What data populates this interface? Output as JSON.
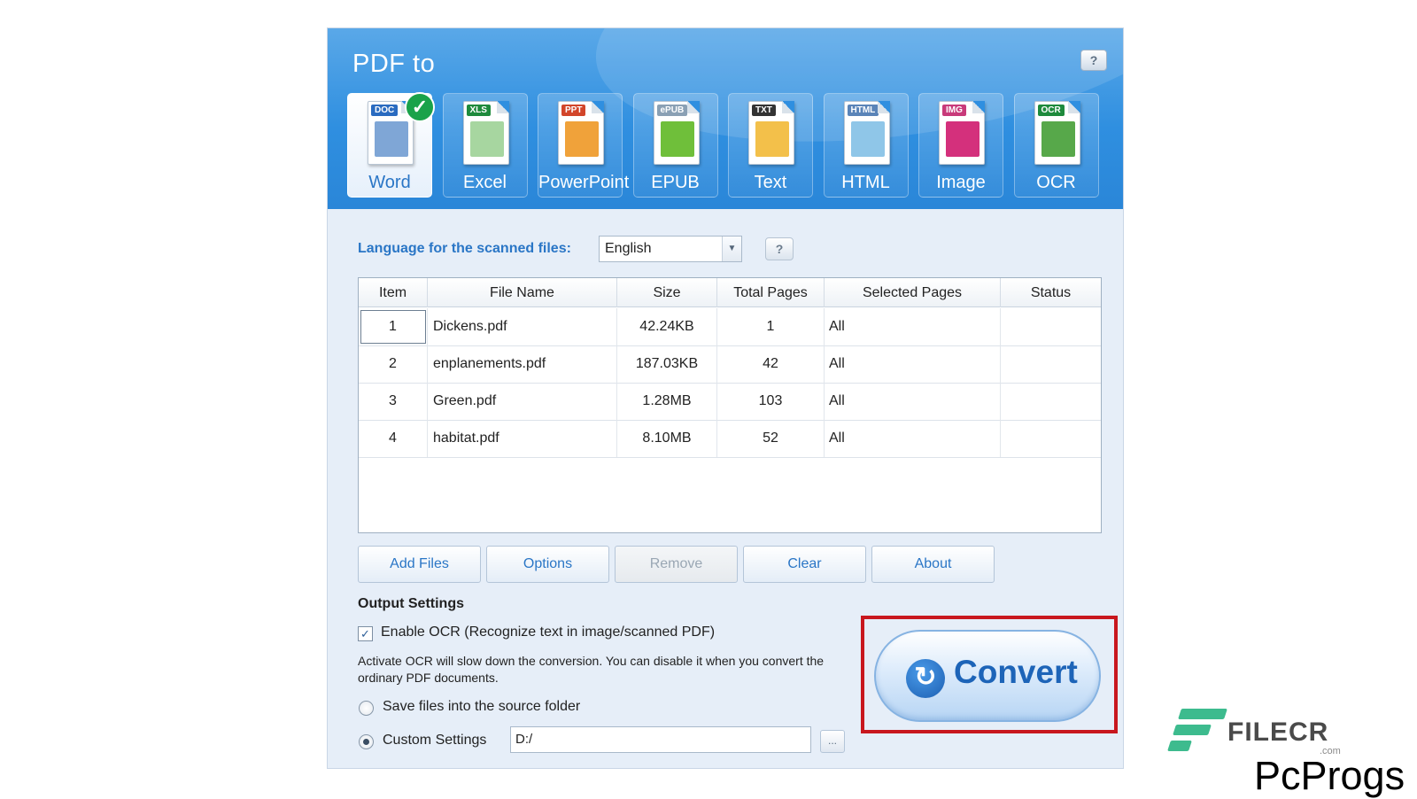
{
  "header": {
    "title": "PDF to",
    "help_label": "?",
    "formats": [
      {
        "label": "Word",
        "tag": "DOC",
        "tag_color": "#2a6bc0",
        "pic_color": "#7fa6d6",
        "selected": true
      },
      {
        "label": "Excel",
        "tag": "XLS",
        "tag_color": "#1e8a3c",
        "pic_color": "#a7d6a0"
      },
      {
        "label": "PowerPoint",
        "tag": "PPT",
        "tag_color": "#d2452a",
        "pic_color": "#f0a23a"
      },
      {
        "label": "EPUB",
        "tag": "ePUB",
        "tag_color": "#8aa0b4",
        "pic_color": "#6fbf3a"
      },
      {
        "label": "Text",
        "tag": "TXT",
        "tag_color": "#333333",
        "pic_color": "#f3c04a"
      },
      {
        "label": "HTML",
        "tag": "HTML",
        "tag_color": "#5a84b8",
        "pic_color": "#8fc6e8"
      },
      {
        "label": "Image",
        "tag": "IMG",
        "tag_color": "#c83a7a",
        "pic_color": "#d4307c"
      },
      {
        "label": "OCR",
        "tag": "OCR",
        "tag_color": "#1e8a3c",
        "pic_color": "#57a84a"
      }
    ]
  },
  "language": {
    "label": "Language for the scanned files:",
    "value": "English",
    "help_label": "?"
  },
  "table": {
    "headers": [
      "Item",
      "File Name",
      "Size",
      "Total Pages",
      "Selected Pages",
      "Status"
    ],
    "rows": [
      {
        "item": "1",
        "file": "Dickens.pdf",
        "size": "42.24KB",
        "pages": "1",
        "selected": "All",
        "status": ""
      },
      {
        "item": "2",
        "file": "enplanements.pdf",
        "size": "187.03KB",
        "pages": "42",
        "selected": "All",
        "status": ""
      },
      {
        "item": "3",
        "file": "Green.pdf",
        "size": "1.28MB",
        "pages": "103",
        "selected": "All",
        "status": ""
      },
      {
        "item": "4",
        "file": "habitat.pdf",
        "size": "8.10MB",
        "pages": "52",
        "selected": "All",
        "status": ""
      }
    ]
  },
  "buttons": {
    "add_files": "Add Files",
    "options": "Options",
    "remove": "Remove",
    "clear": "Clear",
    "about": "About"
  },
  "output": {
    "title": "Output Settings",
    "ocr_label": "Enable OCR (Recognize text in image/scanned PDF)",
    "ocr_checked": true,
    "ocr_note": "Activate OCR will slow down the conversion. You can disable it when you convert the ordinary PDF documents.",
    "save_source_label": "Save files into the source folder",
    "custom_label": "Custom Settings",
    "path_value": "D:/",
    "browse_label": "..."
  },
  "convert": {
    "label": "Convert"
  },
  "watermark": {
    "brand": "FILECR",
    "suffix": ".com",
    "site": "PcProgs"
  }
}
